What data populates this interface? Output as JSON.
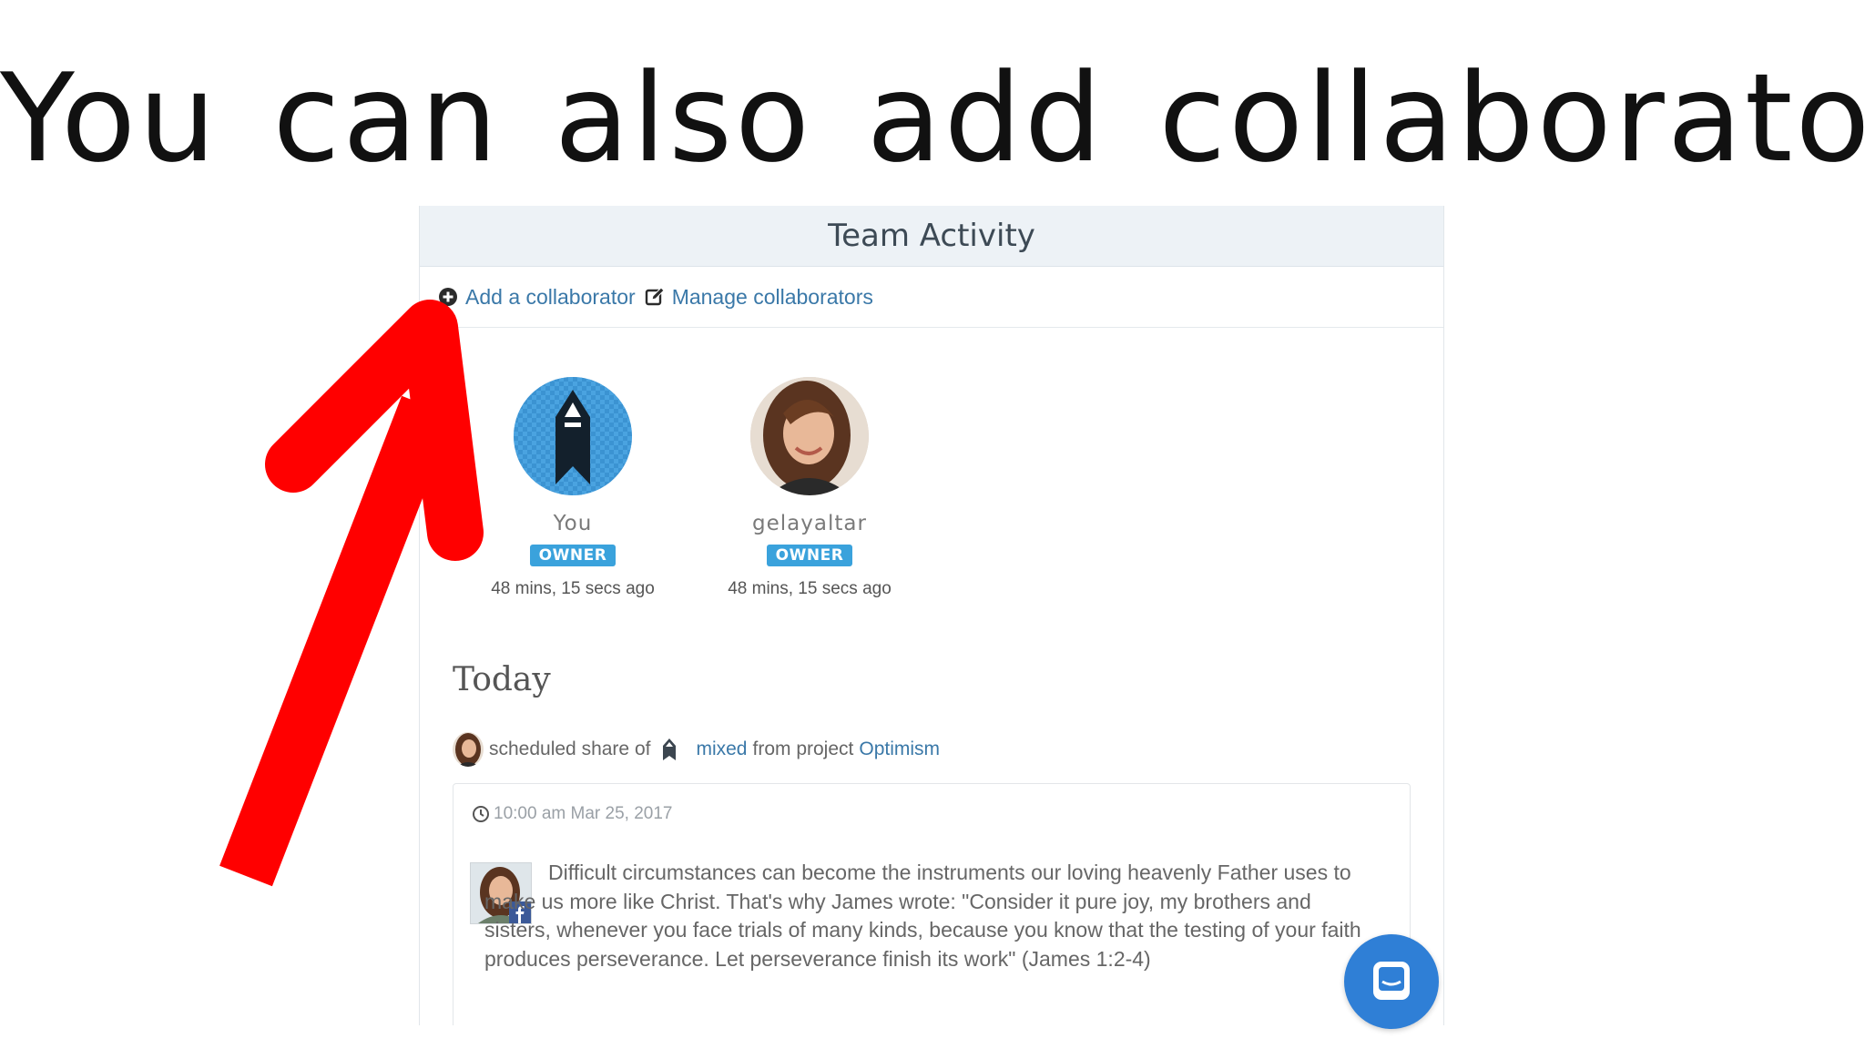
{
  "slide": {
    "title": "You can also add collaborator"
  },
  "panel": {
    "title": "Team Activity",
    "collaborators_bar": {
      "add_label": "Add a collaborator",
      "manage_label": "Manage collaborators"
    },
    "members": [
      {
        "name": "You",
        "role": "OWNER",
        "last_seen": "48 mins, 15 secs ago"
      },
      {
        "name": "gelayaltar",
        "role": "OWNER",
        "last_seen": "48 mins, 15 secs ago"
      }
    ],
    "section_heading": "Today",
    "activity": {
      "text_before": "scheduled share of",
      "item_link": "mixed",
      "text_middle": "from project",
      "project_link": "Optimism"
    },
    "post": {
      "time": "10:00 am Mar 25, 2017",
      "text": "Difficult circumstances can become the instruments our loving heavenly Father uses to make us more like Christ. That's why James wrote: \"Consider it pure joy, my brothers and sisters, whenever you face trials of many kinds, because you know that the testing of your faith produces perseverance. Let perseverance finish its work\" (James 1:2-4)"
    }
  },
  "icons": {
    "add": "plus-circle-icon",
    "manage": "edit-icon",
    "clock": "clock-icon",
    "network": "facebook-icon",
    "chat": "chat-icon",
    "pointer": "red-arrow-icon"
  },
  "colors": {
    "accent_link": "#3a78a8",
    "badge": "#3aa2dc",
    "header_bg": "#edf2f6",
    "arrow": "#ff0000",
    "chat_button": "#2f7fd6"
  }
}
